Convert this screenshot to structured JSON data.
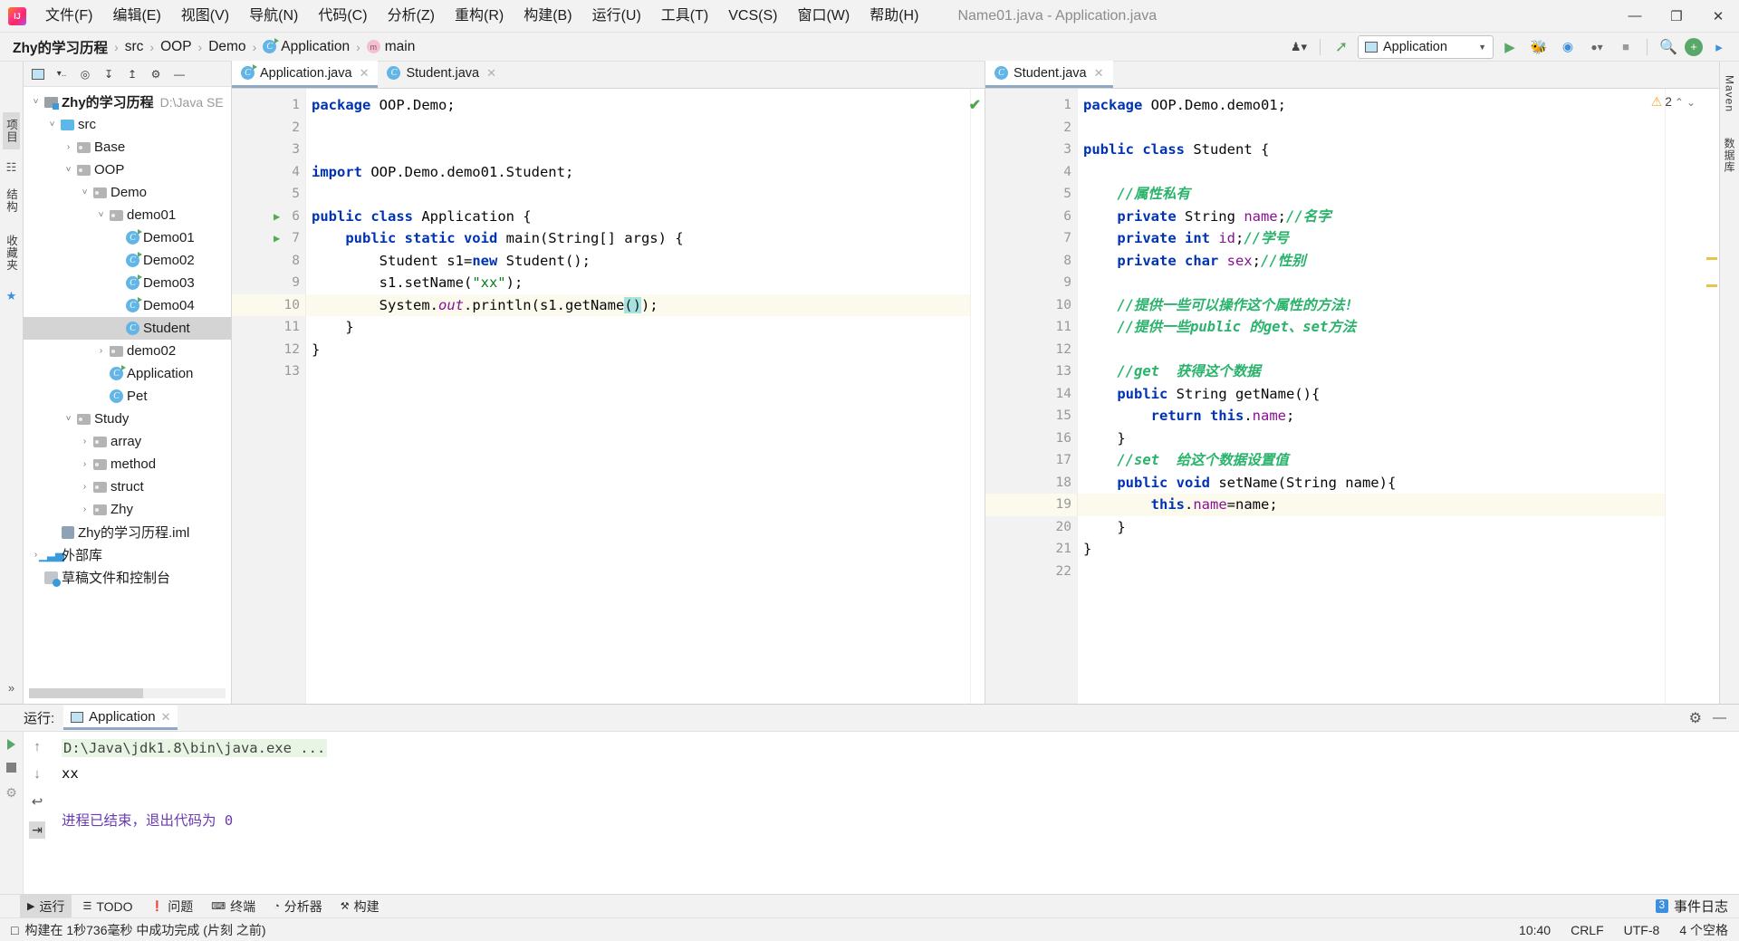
{
  "window": {
    "title": "Name01.java - Application.java",
    "minimize": "—",
    "maximize": "❐",
    "close": "✕"
  },
  "menu": [
    {
      "label": "文件(F)"
    },
    {
      "label": "编辑(E)"
    },
    {
      "label": "视图(V)"
    },
    {
      "label": "导航(N)"
    },
    {
      "label": "代码(C)"
    },
    {
      "label": "分析(Z)"
    },
    {
      "label": "重构(R)"
    },
    {
      "label": "构建(B)"
    },
    {
      "label": "运行(U)"
    },
    {
      "label": "工具(T)"
    },
    {
      "label": "VCS(S)"
    },
    {
      "label": "窗口(W)"
    },
    {
      "label": "帮助(H)"
    }
  ],
  "breadcrumb": {
    "items": [
      {
        "label": "Zhy的学习历程",
        "icon": ""
      },
      {
        "label": "src",
        "icon": ""
      },
      {
        "label": "OOP",
        "icon": ""
      },
      {
        "label": "Demo",
        "icon": ""
      },
      {
        "label": "Application",
        "icon": "class-icon"
      },
      {
        "label": "main",
        "icon": "method-icon"
      }
    ],
    "separator": "›"
  },
  "navbar_right": {
    "run_config": "Application",
    "caret": "▼",
    "buttons": [
      {
        "name": "user-icon",
        "glyph": "♟"
      },
      {
        "name": "hammer-icon",
        "glyph": "⚒"
      },
      {
        "name": "run-icon",
        "glyph": "▶"
      },
      {
        "name": "debug-icon",
        "glyph": "⚙"
      },
      {
        "name": "run-coverage-icon",
        "glyph": "◔"
      },
      {
        "name": "profile-icon",
        "glyph": "◉"
      },
      {
        "name": "stop-icon",
        "glyph": "■"
      },
      {
        "name": "search-icon",
        "glyph": "⌕"
      },
      {
        "name": "updates-icon",
        "glyph": "+"
      },
      {
        "name": "ide-and-project-settings-icon",
        "glyph": "▶"
      }
    ]
  },
  "left_rail": {
    "project_label": "项目",
    "structure_label": "结构",
    "favorites_label": "收藏夹",
    "star": "★",
    "expand": "»"
  },
  "project_pane": {
    "toolbar_icons": [
      {
        "name": "project-view-selector-icon",
        "glyph": "▣"
      },
      {
        "name": "filter-icon",
        "glyph": "▾"
      },
      {
        "name": "locate-icon",
        "glyph": "⌖"
      },
      {
        "name": "expand-all-icon",
        "glyph": "↧"
      },
      {
        "name": "collapse-all-icon",
        "glyph": "↥"
      },
      {
        "name": "settings-gear-icon",
        "glyph": "⚙"
      },
      {
        "name": "hide-icon",
        "glyph": "—"
      }
    ],
    "tree": [
      {
        "label": "Zhy的学习历程",
        "path": "D:\\Java SE",
        "depth": 0,
        "twist": "v",
        "icon": "module",
        "bold": true,
        "selected": false
      },
      {
        "label": "src",
        "depth": 1,
        "twist": "v",
        "icon": "src-folder",
        "selected": false
      },
      {
        "label": "Base",
        "depth": 2,
        "twist": ">",
        "icon": "package",
        "selected": false
      },
      {
        "label": "OOP",
        "depth": 2,
        "twist": "v",
        "icon": "package",
        "selected": false
      },
      {
        "label": "Demo",
        "depth": 3,
        "twist": "v",
        "icon": "package",
        "selected": false
      },
      {
        "label": "demo01",
        "depth": 4,
        "twist": "v",
        "icon": "package",
        "selected": false
      },
      {
        "label": "Demo01",
        "depth": 5,
        "twist": "",
        "icon": "class-run",
        "selected": false
      },
      {
        "label": "Demo02",
        "depth": 5,
        "twist": "",
        "icon": "class-run",
        "selected": false
      },
      {
        "label": "Demo03",
        "depth": 5,
        "twist": "",
        "icon": "class-run",
        "selected": false
      },
      {
        "label": "Demo04",
        "depth": 5,
        "twist": "",
        "icon": "class-run",
        "selected": false
      },
      {
        "label": "Student",
        "depth": 5,
        "twist": "",
        "icon": "class",
        "selected": true
      },
      {
        "label": "demo02",
        "depth": 4,
        "twist": ">",
        "icon": "package",
        "selected": false
      },
      {
        "label": "Application",
        "depth": 4,
        "twist": "",
        "icon": "class-run",
        "selected": false
      },
      {
        "label": "Pet",
        "depth": 4,
        "twist": "",
        "icon": "class",
        "selected": false
      },
      {
        "label": "Study",
        "depth": 2,
        "twist": "v",
        "icon": "package",
        "selected": false
      },
      {
        "label": "array",
        "depth": 3,
        "twist": ">",
        "icon": "package",
        "selected": false
      },
      {
        "label": "method",
        "depth": 3,
        "twist": ">",
        "icon": "package",
        "selected": false
      },
      {
        "label": "struct",
        "depth": 3,
        "twist": ">",
        "icon": "package",
        "selected": false
      },
      {
        "label": "Zhy",
        "depth": 3,
        "twist": ">",
        "icon": "package",
        "selected": false
      },
      {
        "label": "Zhy的学习历程.iml",
        "depth": 1,
        "twist": "",
        "icon": "iml",
        "selected": false
      },
      {
        "label": "外部库",
        "depth": 0,
        "twist": ">",
        "icon": "library",
        "selected": false
      },
      {
        "label": "草稿文件和控制台",
        "depth": 0,
        "twist": "",
        "icon": "scratch",
        "selected": false
      }
    ]
  },
  "editor_left": {
    "tabs": [
      {
        "label": "Application.java",
        "icon": "class-run-icon",
        "active": true,
        "close": "✕"
      },
      {
        "label": "Student.java",
        "icon": "class-icon",
        "active": false,
        "close": "✕"
      }
    ],
    "inspection_ok": "✔",
    "highlighted_line": 10,
    "lines": [
      {
        "n": 1,
        "gutter": "",
        "fold": "",
        "tokens": [
          {
            "t": "package ",
            "c": "kw"
          },
          {
            "t": "OOP.Demo;",
            "c": "plain"
          }
        ]
      },
      {
        "n": 2,
        "gutter": "",
        "fold": "",
        "tokens": []
      },
      {
        "n": 3,
        "gutter": "",
        "fold": "",
        "tokens": []
      },
      {
        "n": 4,
        "gutter": "",
        "fold": "",
        "tokens": [
          {
            "t": "import ",
            "c": "kw"
          },
          {
            "t": "OOP.Demo.demo01.Student;",
            "c": "plain"
          }
        ]
      },
      {
        "n": 5,
        "gutter": "",
        "fold": "",
        "tokens": []
      },
      {
        "n": 6,
        "gutter": "run",
        "fold": "",
        "tokens": [
          {
            "t": "public class ",
            "c": "kw"
          },
          {
            "t": "Application {",
            "c": "plain"
          }
        ]
      },
      {
        "n": 7,
        "gutter": "run",
        "fold": "-",
        "tokens": [
          {
            "t": "    public static void ",
            "c": "kw"
          },
          {
            "t": "main(String[] args) {",
            "c": "plain"
          }
        ]
      },
      {
        "n": 8,
        "gutter": "",
        "fold": "",
        "tokens": [
          {
            "t": "        Student s1=",
            "c": "plain"
          },
          {
            "t": "new ",
            "c": "kw"
          },
          {
            "t": "Student();",
            "c": "plain"
          }
        ]
      },
      {
        "n": 9,
        "gutter": "",
        "fold": "",
        "tokens": [
          {
            "t": "        s1.setName(",
            "c": "plain"
          },
          {
            "t": "\"xx\"",
            "c": "st"
          },
          {
            "t": ");",
            "c": "plain"
          }
        ]
      },
      {
        "n": 10,
        "gutter": "",
        "fold": "",
        "tokens": [
          {
            "t": "        System.",
            "c": "plain"
          },
          {
            "t": "out",
            "c": "stat"
          },
          {
            "t": ".println(s1.getName",
            "c": "plain"
          },
          {
            "t": "()",
            "c": "sel"
          },
          {
            "t": ");",
            "c": "plain"
          }
        ]
      },
      {
        "n": 11,
        "gutter": "",
        "fold": "-",
        "tokens": [
          {
            "t": "    }",
            "c": "plain"
          }
        ]
      },
      {
        "n": 12,
        "gutter": "",
        "fold": "",
        "tokens": [
          {
            "t": "}",
            "c": "plain"
          }
        ]
      },
      {
        "n": 13,
        "gutter": "",
        "fold": "",
        "tokens": []
      }
    ]
  },
  "editor_right": {
    "tabs": [
      {
        "label": "Student.java",
        "icon": "class-icon",
        "active": true,
        "close": "✕"
      }
    ],
    "warning_count": "2",
    "warning_glyph": "⚠",
    "chevron_up": "⌃",
    "chevron_down": "⌄",
    "highlighted_line": 19,
    "lines": [
      {
        "n": 1,
        "gutter": "",
        "fold": "",
        "tokens": [
          {
            "t": "package ",
            "c": "kw"
          },
          {
            "t": "OOP.Demo.demo01;",
            "c": "plain"
          }
        ]
      },
      {
        "n": 2,
        "gutter": "",
        "fold": "",
        "tokens": []
      },
      {
        "n": 3,
        "gutter": "",
        "fold": "",
        "tokens": [
          {
            "t": "public class ",
            "c": "kw"
          },
          {
            "t": "Student {",
            "c": "plain"
          }
        ]
      },
      {
        "n": 4,
        "gutter": "",
        "fold": "",
        "tokens": []
      },
      {
        "n": 5,
        "gutter": "",
        "fold": "",
        "tokens": [
          {
            "t": "    //属性私有",
            "c": "cm"
          }
        ]
      },
      {
        "n": 6,
        "gutter": "",
        "fold": "",
        "tokens": [
          {
            "t": "    private ",
            "c": "kw"
          },
          {
            "t": "String ",
            "c": "plain"
          },
          {
            "t": "name",
            "c": "fld"
          },
          {
            "t": ";",
            "c": "plain"
          },
          {
            "t": "//名字",
            "c": "cm"
          }
        ]
      },
      {
        "n": 7,
        "gutter": "",
        "fold": "",
        "tokens": [
          {
            "t": "    private int ",
            "c": "kw"
          },
          {
            "t": "id",
            "c": "fld"
          },
          {
            "t": ";",
            "c": "plain"
          },
          {
            "t": "//学号",
            "c": "cm"
          }
        ]
      },
      {
        "n": 8,
        "gutter": "",
        "fold": "",
        "tokens": [
          {
            "t": "    private char ",
            "c": "kw"
          },
          {
            "t": "sex",
            "c": "fld"
          },
          {
            "t": ";",
            "c": "plain"
          },
          {
            "t": "//性别",
            "c": "cm"
          }
        ]
      },
      {
        "n": 9,
        "gutter": "",
        "fold": "",
        "tokens": []
      },
      {
        "n": 10,
        "gutter": "",
        "fold": "v",
        "tokens": [
          {
            "t": "    //提供一些可以操作这个属性的方法!",
            "c": "cm"
          }
        ]
      },
      {
        "n": 11,
        "gutter": "",
        "fold": "-",
        "tokens": [
          {
            "t": "    //提供一些public 的get、set方法",
            "c": "cm"
          }
        ]
      },
      {
        "n": 12,
        "gutter": "",
        "fold": "",
        "tokens": []
      },
      {
        "n": 13,
        "gutter": "",
        "fold": "",
        "tokens": [
          {
            "t": "    //get  获得这个数据",
            "c": "cm"
          }
        ]
      },
      {
        "n": 14,
        "gutter": "",
        "fold": "v",
        "tokens": [
          {
            "t": "    public ",
            "c": "kw"
          },
          {
            "t": "String getName(){",
            "c": "plain"
          }
        ]
      },
      {
        "n": 15,
        "gutter": "",
        "fold": "",
        "tokens": [
          {
            "t": "        return this",
            "c": "kw"
          },
          {
            "t": ".",
            "c": "plain"
          },
          {
            "t": "name",
            "c": "fld"
          },
          {
            "t": ";",
            "c": "plain"
          }
        ]
      },
      {
        "n": 16,
        "gutter": "",
        "fold": "-",
        "tokens": [
          {
            "t": "    }",
            "c": "plain"
          }
        ]
      },
      {
        "n": 17,
        "gutter": "",
        "fold": "",
        "tokens": [
          {
            "t": "    //set  给这个数据设置值",
            "c": "cm"
          }
        ]
      },
      {
        "n": 18,
        "gutter": "",
        "fold": "v",
        "tokens": [
          {
            "t": "    public void ",
            "c": "kw"
          },
          {
            "t": "setName(String name){",
            "c": "plain"
          }
        ]
      },
      {
        "n": 19,
        "gutter": "",
        "fold": "",
        "tokens": [
          {
            "t": "        this",
            "c": "kw"
          },
          {
            "t": ".",
            "c": "plain"
          },
          {
            "t": "name",
            "c": "fld"
          },
          {
            "t": "=name;",
            "c": "plain"
          }
        ]
      },
      {
        "n": 20,
        "gutter": "",
        "fold": "",
        "tokens": [
          {
            "t": "    }",
            "c": "plain"
          }
        ]
      },
      {
        "n": 21,
        "gutter": "",
        "fold": "",
        "tokens": [
          {
            "t": "}",
            "c": "plain"
          }
        ]
      },
      {
        "n": 22,
        "gutter": "",
        "fold": "",
        "tokens": []
      }
    ]
  },
  "right_rail": {
    "maven_label": "Maven",
    "database_label": "数据库"
  },
  "run_panel": {
    "label": "运行:",
    "tab_label": "Application",
    "tab_close": "✕",
    "settings_glyph": "⚙",
    "hide_glyph": "—",
    "side_icons": [
      {
        "name": "rerun-icon",
        "glyph": "▶"
      },
      {
        "name": "stop-icon",
        "glyph": "■"
      },
      {
        "name": "dump-threads-icon",
        "glyph": "☷"
      }
    ],
    "side2_icons": [
      {
        "name": "scroll-up-icon",
        "glyph": "↑"
      },
      {
        "name": "scroll-down-icon",
        "glyph": "↓"
      },
      {
        "name": "soft-wrap-icon",
        "glyph": "↩"
      },
      {
        "name": "scroll-to-end-icon",
        "glyph": "⇥"
      }
    ],
    "console": {
      "command": "D:\\Java\\jdk1.8\\bin\\java.exe ...",
      "output": "xx",
      "exit_message": "进程已结束，退出代码为 0"
    }
  },
  "status_tools": {
    "items": [
      {
        "label": "运行",
        "icon": "▶",
        "active": true
      },
      {
        "label": "TODO",
        "icon": "☰",
        "active": false
      },
      {
        "label": "问题",
        "icon": "❗",
        "active": false
      },
      {
        "label": "终端",
        "icon": "⌨",
        "active": false
      },
      {
        "label": "分析器",
        "icon": "◔",
        "active": false
      },
      {
        "label": "构建",
        "icon": "⚒",
        "active": false
      }
    ],
    "event_log": {
      "count": "3",
      "label": "事件日志"
    }
  },
  "statusbar": {
    "message": "构建在 1秒736毫秒 中成功完成 (片刻 之前)",
    "message_icon": "□",
    "time": "10:40",
    "line_separator": "CRLF",
    "encoding": "UTF-8",
    "indent": "4 个空格"
  }
}
